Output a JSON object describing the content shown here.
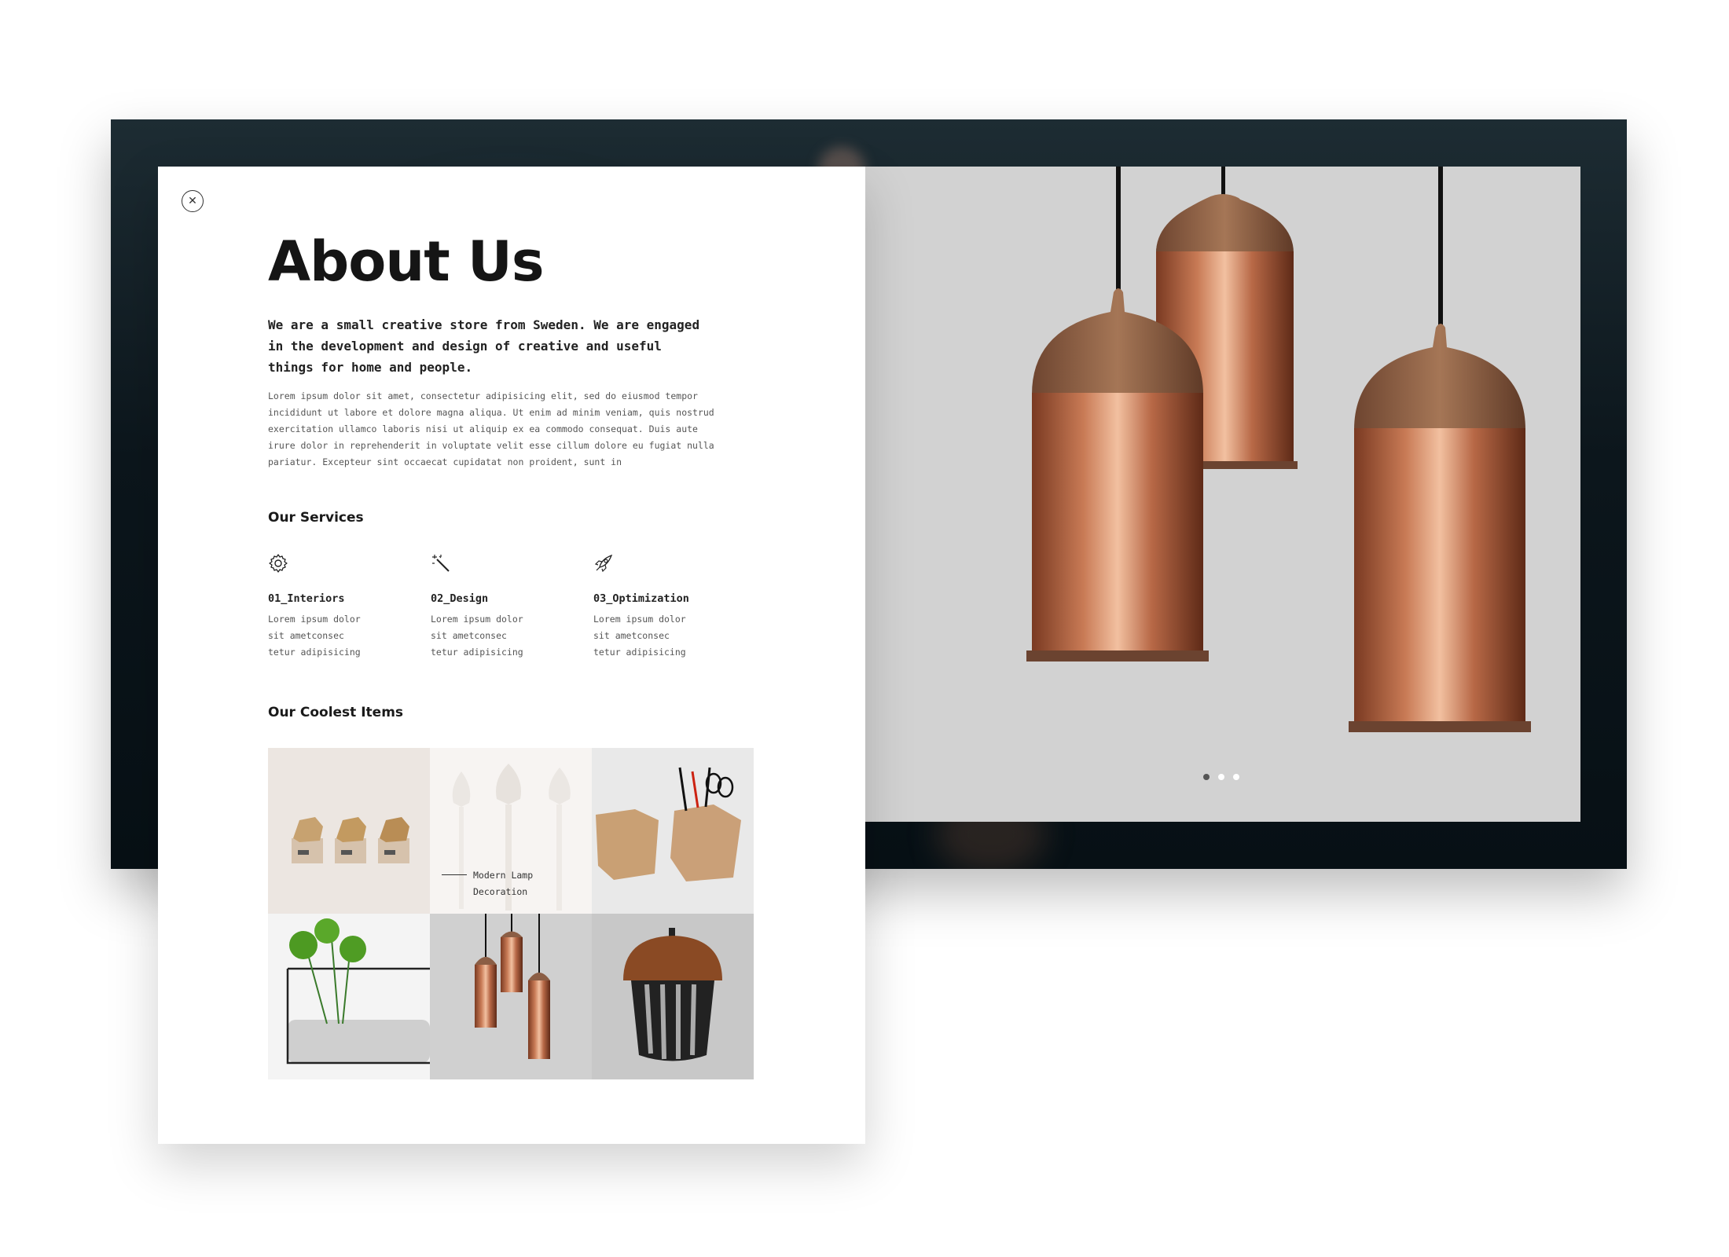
{
  "about": {
    "title": "About Us",
    "lead": "We are a small creative store from Sweden. We are engaged in the development and design of creative and useful things for home and people.",
    "body": "Lorem ipsum dolor sit amet, consectetur adipisicing elit, sed do eiusmod tempor incididunt ut labore et dolore magna aliqua. Ut enim ad minim veniam, quis nostrud exercitation ullamco laboris nisi ut aliquip ex ea commodo consequat. Duis aute irure dolor in reprehenderit in voluptate velit esse cillum dolore eu fugiat nulla pariatur. Excepteur sint occaecat cupidatat non proident, sunt in"
  },
  "close_icon": "close-icon",
  "services": {
    "title": "Our Services",
    "items": [
      {
        "icon": "gear-icon",
        "title": "01_Interiors",
        "desc": "Lorem ipsum dolor sit ametconsec tetur adipisicing"
      },
      {
        "icon": "magic-wand-icon",
        "title": "02_Design",
        "desc": "Lorem ipsum dolor sit ametconsec tetur adipisicing"
      },
      {
        "icon": "rocket-icon",
        "title": "03_Optimization",
        "desc": "Lorem ipsum dolor sit ametconsec tetur adipisicing"
      }
    ]
  },
  "items": {
    "title": "Our Coolest Items",
    "caption": "Modern Lamp Decoration",
    "tiles": [
      "geometric-wooden-boxes",
      "white-lamps",
      "wooden-pen-holders",
      "green-flowers-vase",
      "copper-pendant-lamps",
      "wooden-acorn-lamp"
    ]
  },
  "slider": {
    "slide_count": 3,
    "active_index": 0
  },
  "colors": {
    "hero_bg": "#d2d2d2",
    "copper": "#b56a47",
    "wood": "#8b5e45",
    "frame_dark": "#0c161c"
  }
}
